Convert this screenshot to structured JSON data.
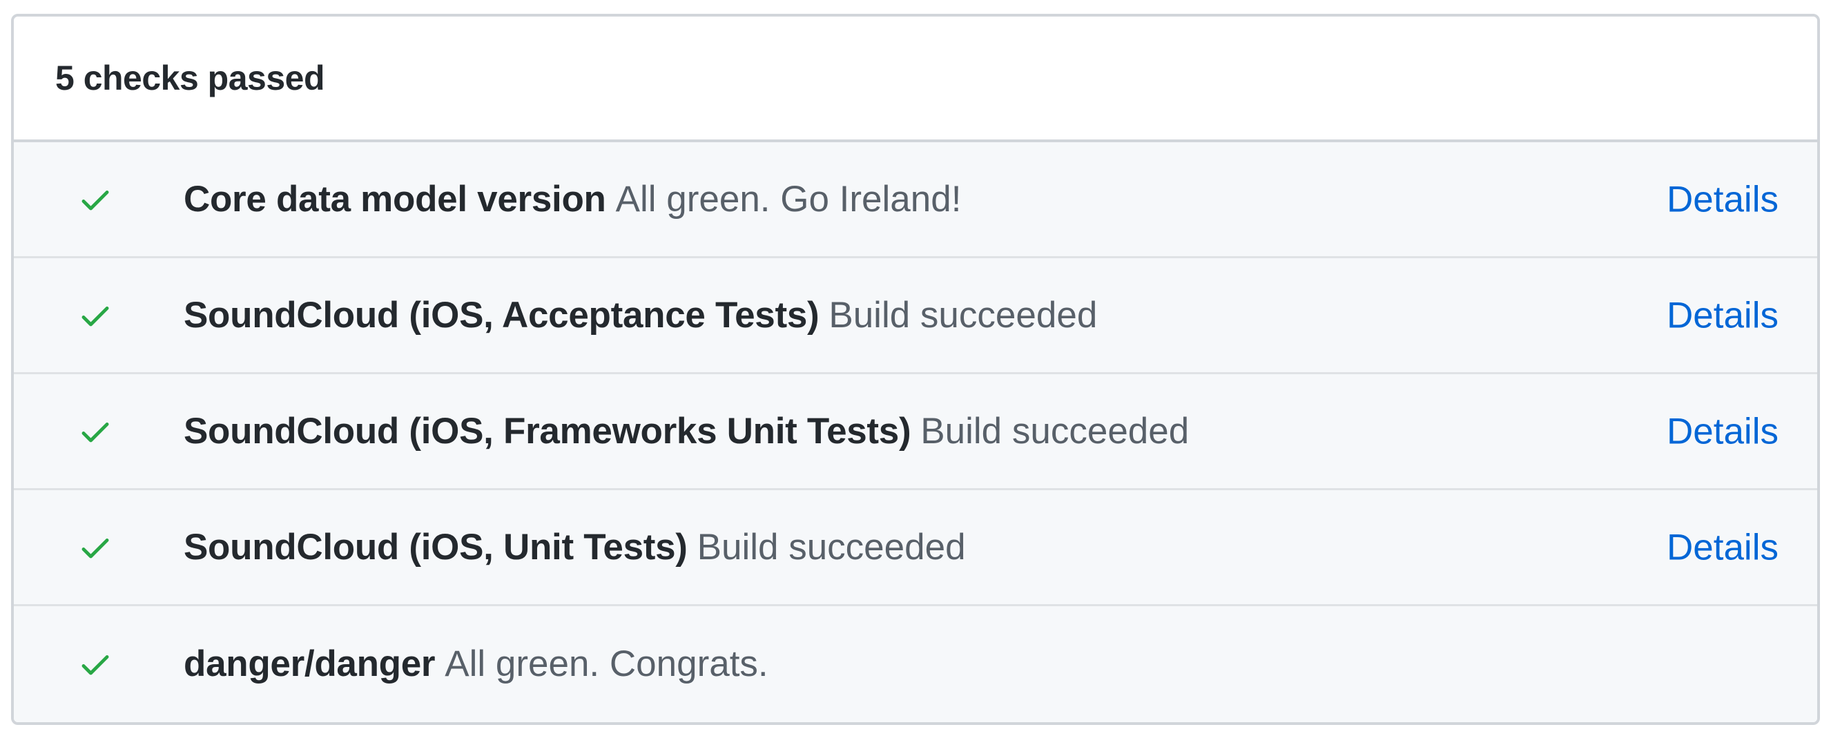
{
  "header": {
    "title": "5 checks passed"
  },
  "colors": {
    "success": "#28a745",
    "link": "#0366d6",
    "muted": "#586069",
    "text": "#24292e",
    "border": "#d1d5da",
    "row_bg": "#f6f8fa"
  },
  "checks": [
    {
      "name": "Core data model version",
      "status": "All green. Go Ireland!",
      "details_label": "Details",
      "icon": "check-icon"
    },
    {
      "name": "SoundCloud (iOS, Acceptance Tests)",
      "status": "Build succeeded",
      "details_label": "Details",
      "icon": "check-icon"
    },
    {
      "name": "SoundCloud (iOS, Frameworks Unit Tests)",
      "status": "Build succeeded",
      "details_label": "Details",
      "icon": "check-icon"
    },
    {
      "name": "SoundCloud (iOS, Unit Tests)",
      "status": "Build succeeded",
      "details_label": "Details",
      "icon": "check-icon"
    },
    {
      "name": "danger/danger",
      "status": "All green. Congrats.",
      "icon": "check-icon"
    }
  ]
}
